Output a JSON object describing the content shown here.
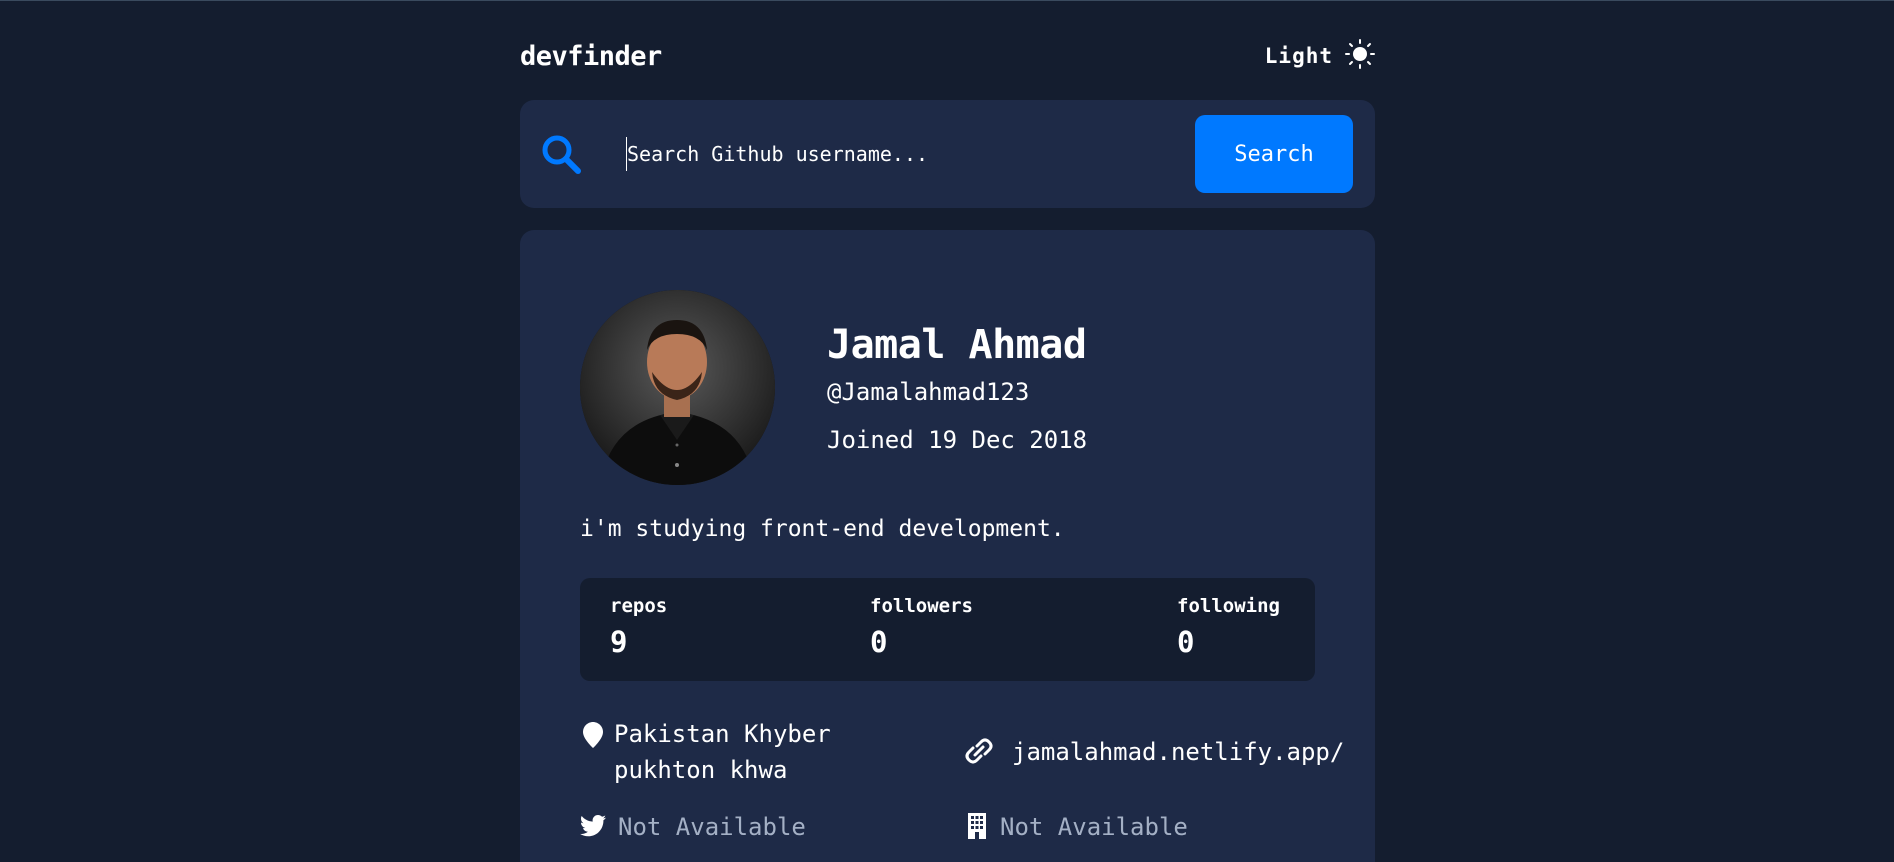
{
  "app": {
    "title": "devfinder"
  },
  "theme_toggle": {
    "label": "Light",
    "icon": "sun-icon"
  },
  "search": {
    "placeholder": "Search Github username...",
    "button_label": "Search",
    "icon": "search-icon"
  },
  "profile": {
    "name": "Jamal Ahmad",
    "login": "@Jamalahmad123",
    "joined": "Joined 19 Dec 2018",
    "bio": "i'm studying front-end development.",
    "stats": [
      {
        "label": "repos",
        "value": "9"
      },
      {
        "label": "followers",
        "value": "0"
      },
      {
        "label": "following",
        "value": "0"
      }
    ],
    "location_line1": "Pakistan Khyber",
    "location_line2": "pukhton khwa",
    "website": "jamalahmad.netlify.app/",
    "twitter": "Not Available",
    "company": "Not Available"
  },
  "colors": {
    "background": "#141d2f",
    "card": "#1e2a47",
    "accent": "#0079ff",
    "muted": "#a4b0c5"
  }
}
